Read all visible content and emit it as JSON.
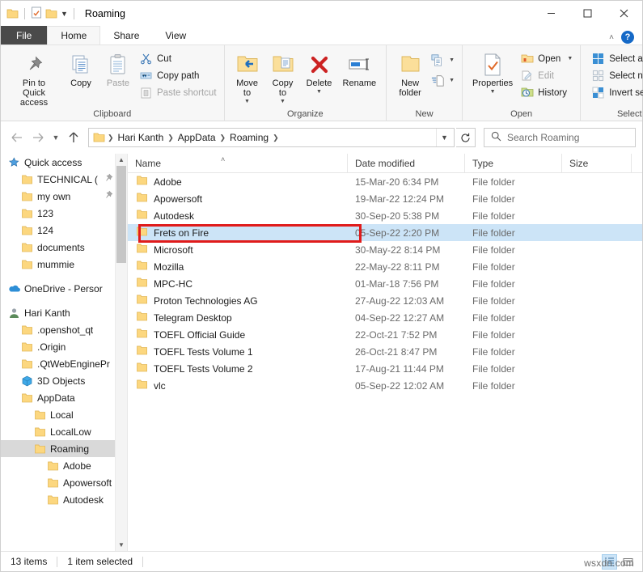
{
  "window": {
    "title": "Roaming",
    "quick_access_icons": [
      "folder-icon",
      "properties-icon",
      "new-folder-icon",
      "customize-dropdown-icon"
    ],
    "minimize_label": "—",
    "maximize_label": "☐",
    "close_label": "✕"
  },
  "tabs": [
    {
      "label": "File"
    },
    {
      "label": "Home"
    },
    {
      "label": "Share"
    },
    {
      "label": "View"
    }
  ],
  "ribbon_right": {
    "collapse_label": "˄",
    "help_label": "?"
  },
  "ribbon": {
    "groups": [
      {
        "title": "Clipboard",
        "big": [
          {
            "label": "Pin to Quick\naccess",
            "icon": "pin-icon",
            "disabled": false
          },
          {
            "label": "Copy",
            "icon": "copy-icon",
            "disabled": false
          },
          {
            "label": "Paste",
            "icon": "paste-icon",
            "disabled": true
          }
        ],
        "small": [
          {
            "label": "Cut",
            "icon": "scissors-icon",
            "disabled": false
          },
          {
            "label": "Copy path",
            "icon": "copy-path-icon",
            "disabled": false
          },
          {
            "label": "Paste shortcut",
            "icon": "paste-shortcut-icon",
            "disabled": true
          }
        ]
      },
      {
        "title": "Organize",
        "big": [
          {
            "label": "Move\nto",
            "icon": "move-to-icon",
            "caret": true
          },
          {
            "label": "Copy\nto",
            "icon": "copy-to-icon",
            "caret": true
          },
          {
            "label": "Delete",
            "icon": "delete-icon",
            "caret": true
          },
          {
            "label": "Rename",
            "icon": "rename-icon",
            "caret": false
          }
        ],
        "small": []
      },
      {
        "title": "New",
        "big": [
          {
            "label": "New\nfolder",
            "icon": "new-folder-icon",
            "caret": false
          }
        ],
        "small": [
          {
            "label": "",
            "icon": "new-item-icon",
            "caret": true
          },
          {
            "label": "",
            "icon": "easy-access-icon",
            "caret": true
          }
        ]
      },
      {
        "title": "Open",
        "big": [
          {
            "label": "Properties",
            "icon": "properties-icon",
            "caret": true
          }
        ],
        "small": [
          {
            "label": "Open",
            "icon": "open-icon",
            "caret": true,
            "disabled": false
          },
          {
            "label": "Edit",
            "icon": "edit-icon",
            "disabled": true
          },
          {
            "label": "History",
            "icon": "history-icon",
            "disabled": false
          }
        ]
      },
      {
        "title": "Select",
        "big": [],
        "small": [
          {
            "label": "Select all",
            "icon": "select-all-icon",
            "disabled": false
          },
          {
            "label": "Select none",
            "icon": "select-none-icon",
            "disabled": false
          },
          {
            "label": "Invert selection",
            "icon": "invert-selection-icon",
            "disabled": false
          }
        ]
      }
    ]
  },
  "address": {
    "back_icon": "arrow-left-icon",
    "forward_icon": "arrow-right-icon",
    "recent_icon": "chevron-down-icon",
    "up_icon": "arrow-up-icon",
    "breadcrumbs": [
      "Hari Kanth",
      "AppData",
      "Roaming"
    ],
    "dropdown_icon": "chevron-down-icon",
    "refresh_icon": "refresh-icon",
    "search_placeholder": "Search Roaming",
    "search_value": "",
    "search_icon": "search-icon"
  },
  "sidebar": {
    "items": [
      {
        "label": "Quick access",
        "icon": "quick-access-star-icon",
        "indent": 0,
        "selected": false,
        "pinned": false
      },
      {
        "label": "TECHNICAL (",
        "icon": "folder-icon",
        "indent": 1,
        "selected": false,
        "pinned": true
      },
      {
        "label": "my own",
        "icon": "folder-icon",
        "indent": 1,
        "selected": false,
        "pinned": true
      },
      {
        "label": "123",
        "icon": "folder-icon",
        "indent": 1,
        "selected": false,
        "pinned": false
      },
      {
        "label": "124",
        "icon": "folder-icon",
        "indent": 1,
        "selected": false,
        "pinned": false
      },
      {
        "label": "documents",
        "icon": "folder-icon",
        "indent": 1,
        "selected": false,
        "pinned": false
      },
      {
        "label": "mummie",
        "icon": "folder-icon",
        "indent": 1,
        "selected": false,
        "pinned": false
      },
      {
        "label": "",
        "icon": "",
        "indent": 0,
        "selected": false,
        "spacer": true
      },
      {
        "label": "OneDrive - Persor",
        "icon": "onedrive-cloud-icon",
        "indent": 0,
        "selected": false,
        "pinned": false
      },
      {
        "label": "",
        "icon": "",
        "indent": 0,
        "selected": false,
        "spacer": true
      },
      {
        "label": "Hari Kanth",
        "icon": "user-icon",
        "indent": 0,
        "selected": false,
        "pinned": false
      },
      {
        "label": ".openshot_qt",
        "icon": "folder-icon",
        "indent": 1,
        "selected": false,
        "pinned": false
      },
      {
        "label": ".Origin",
        "icon": "folder-icon",
        "indent": 1,
        "selected": false,
        "pinned": false
      },
      {
        "label": ".QtWebEnginePr",
        "icon": "folder-icon",
        "indent": 1,
        "selected": false,
        "pinned": false
      },
      {
        "label": "3D Objects",
        "icon": "3d-objects-icon",
        "indent": 1,
        "selected": false,
        "pinned": false
      },
      {
        "label": "AppData",
        "icon": "folder-icon",
        "indent": 1,
        "selected": false,
        "pinned": false
      },
      {
        "label": "Local",
        "icon": "folder-icon",
        "indent": 2,
        "selected": false,
        "pinned": false
      },
      {
        "label": "LocalLow",
        "icon": "folder-icon",
        "indent": 2,
        "selected": false,
        "pinned": false
      },
      {
        "label": "Roaming",
        "icon": "folder-icon",
        "indent": 2,
        "selected": true,
        "pinned": false
      },
      {
        "label": "Adobe",
        "icon": "folder-icon",
        "indent": 3,
        "selected": false,
        "pinned": false
      },
      {
        "label": "Apowersoft",
        "icon": "folder-icon",
        "indent": 3,
        "selected": false,
        "pinned": false
      },
      {
        "label": "Autodesk",
        "icon": "folder-icon",
        "indent": 3,
        "selected": false,
        "pinned": false
      }
    ],
    "scroll_up_icon": "chevron-up-icon",
    "scroll_down_icon": "chevron-down-icon"
  },
  "filelist": {
    "columns": [
      {
        "key": "name",
        "label": "Name",
        "sorted": true,
        "sort_dir": "asc"
      },
      {
        "key": "date",
        "label": "Date modified"
      },
      {
        "key": "type",
        "label": "Type"
      },
      {
        "key": "size",
        "label": "Size"
      }
    ],
    "sort_arrow": "˄",
    "rows": [
      {
        "name": "Adobe",
        "date": "15-Mar-20 6:34 PM",
        "type": "File folder",
        "size": "",
        "selected": false
      },
      {
        "name": "Apowersoft",
        "date": "19-Mar-22 12:24 PM",
        "type": "File folder",
        "size": "",
        "selected": false
      },
      {
        "name": "Autodesk",
        "date": "30-Sep-20 5:38 PM",
        "type": "File folder",
        "size": "",
        "selected": false
      },
      {
        "name": "Frets on Fire",
        "date": "05-Sep-22 2:20 PM",
        "type": "File folder",
        "size": "",
        "selected": true
      },
      {
        "name": "Microsoft",
        "date": "30-May-22 8:14 PM",
        "type": "File folder",
        "size": "",
        "selected": false
      },
      {
        "name": "Mozilla",
        "date": "22-May-22 8:11 PM",
        "type": "File folder",
        "size": "",
        "selected": false
      },
      {
        "name": "MPC-HC",
        "date": "01-Mar-18 7:56 PM",
        "type": "File folder",
        "size": "",
        "selected": false
      },
      {
        "name": "Proton Technologies AG",
        "date": "27-Aug-22 12:03 AM",
        "type": "File folder",
        "size": "",
        "selected": false
      },
      {
        "name": "Telegram Desktop",
        "date": "04-Sep-22 12:27 AM",
        "type": "File folder",
        "size": "",
        "selected": false
      },
      {
        "name": "TOEFL Official Guide",
        "date": "22-Oct-21 7:52 PM",
        "type": "File folder",
        "size": "",
        "selected": false
      },
      {
        "name": "TOEFL Tests Volume 1",
        "date": "26-Oct-21 8:47 PM",
        "type": "File folder",
        "size": "",
        "selected": false
      },
      {
        "name": "TOEFL Tests Volume 2",
        "date": "17-Aug-21 11:44 PM",
        "type": "File folder",
        "size": "",
        "selected": false
      },
      {
        "name": "vlc",
        "date": "05-Sep-22 12:02 AM",
        "type": "File folder",
        "size": "",
        "selected": false
      }
    ],
    "highlight": {
      "row_index": 3,
      "color": "#e01b1b"
    }
  },
  "statusbar": {
    "item_count": "13 items",
    "selection": "1 item selected",
    "view_details_icon": "details-view-icon",
    "view_large_icons_icon": "large-icons-view-icon"
  },
  "watermark": {
    "text": "wsxdn.com"
  },
  "colors": {
    "selection_blue": "#cce4f7",
    "sidebar_selection": "#d9d9d9",
    "highlight_red": "#e01b1b",
    "folder_yellow": "#fcd77f",
    "ribbon_bg": "#f7f7f7",
    "file_tab": "#4a4a4a",
    "help_blue": "#1569c7"
  }
}
